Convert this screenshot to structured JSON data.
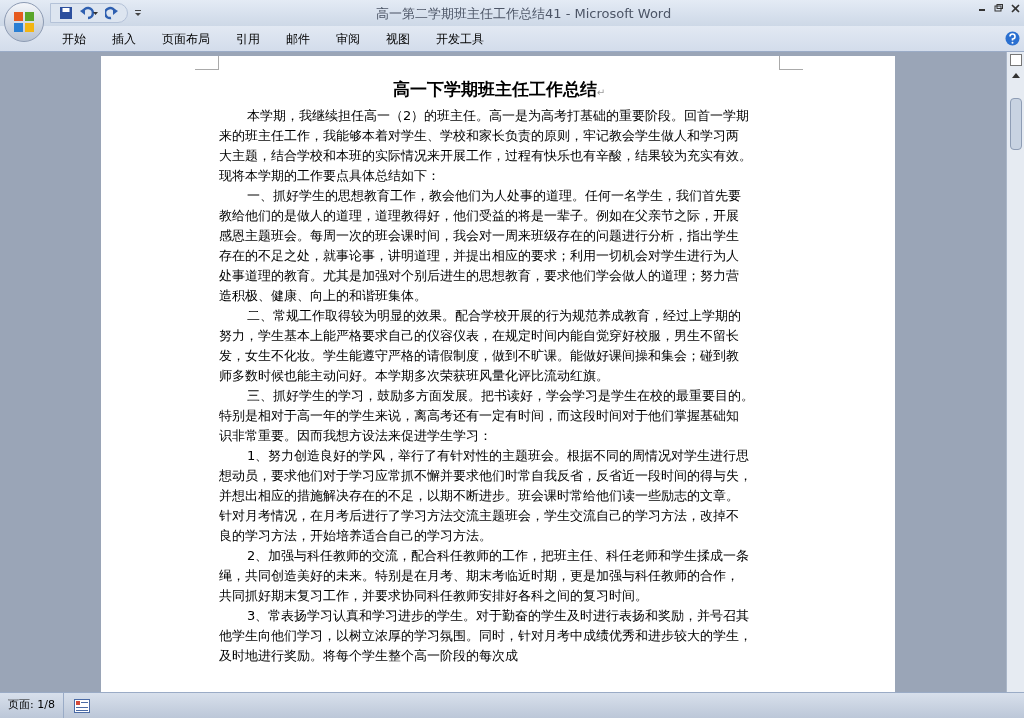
{
  "window": {
    "title": "高一第二学期班主任工作总结41 - Microsoft Word"
  },
  "ribbon_tabs": [
    {
      "label": "开始",
      "selected": false
    },
    {
      "label": "插入",
      "selected": false
    },
    {
      "label": "页面布局",
      "selected": false
    },
    {
      "label": "引用",
      "selected": false
    },
    {
      "label": "邮件",
      "selected": false
    },
    {
      "label": "审阅",
      "selected": false
    },
    {
      "label": "视图",
      "selected": false
    },
    {
      "label": "开发工具",
      "selected": false
    }
  ],
  "document": {
    "title": "高一下学期班主任工作总结",
    "paragraph_mark": "↵",
    "paragraphs": [
      {
        "lines": [
          "本学期，我继续担任高一（2）的班主任。高一是为高考打基础的重要阶段。回首一学期",
          "来的班主任工作，我能够本着对学生、学校和家长负责的原则，牢记教会学生做人和学习两",
          "大主题，结合学校和本班的实际情况来开展工作，过程有快乐也有辛酸，结果较为充实有效。",
          "现将本学期的工作要点具体总结如下："
        ]
      },
      {
        "lines": [
          "一、抓好学生的思想教育工作，教会他们为人处事的道理。任何一名学生，我们首先要",
          "教给他们的是做人的道理，道理教得好，他们受益的将是一辈子。例如在父亲节之际，开展",
          "感恩主题班会。每周一次的班会课时间，我会对一周来班级存在的问题进行分析，指出学生",
          "存在的不足之处，就事论事，讲明道理，并提出相应的要求；利用一切机会对学生进行为人",
          "处事道理的教育。尤其是加强对个别后进生的思想教育，要求他们学会做人的道理；努力营",
          "造积极、健康、向上的和谐班集体。"
        ]
      },
      {
        "lines": [
          "二、常规工作取得较为明显的效果。配合学校开展的行为规范养成教育，经过上学期的",
          "努力，学生基本上能严格要求自己的仪容仪表，在规定时间内能自觉穿好校服，男生不留长",
          "发，女生不化妆。学生能遵守严格的请假制度，做到不旷课。能做好课间操和集会；碰到教",
          "师多数时候也能主动问好。本学期多次荣获班风量化评比流动红旗。"
        ]
      },
      {
        "lines": [
          "三、抓好学生的学习，鼓励多方面发展。把书读好，学会学习是学生在校的最重要目的。",
          "特别是相对于高一年的学生来说，离高考还有一定有时间，而这段时间对于他们掌握基础知",
          "识非常重要。因而我想方设法来促进学生学习："
        ]
      },
      {
        "lines": [
          "1、努力创造良好的学风，举行了有针对性的主题班会。根据不同的周情况对学生进行思",
          "想动员，要求他们对于学习应常抓不懈并要求他们时常自我反省，反省近一段时间的得与失，",
          "并想出相应的措施解决存在的不足，以期不断进步。班会课时常给他们读一些励志的文章。",
          "针对月考情况，在月考后进行了学习方法交流主题班会，学生交流自己的学习方法，改掉不",
          "良的学习方法，开始培养适合自己的学习方法。"
        ]
      },
      {
        "lines": [
          "2、加强与科任教师的交流，配合科任教师的工作，把班主任、科任老师和学生揉成一条",
          "绳，共同创造美好的未来。特别是在月考、期末考临近时期，更是加强与科任教师的合作，",
          "共同抓好期末复习工作，并要求协同科任教师安排好各科之间的复习时间。"
        ]
      },
      {
        "lines": [
          "3、常表扬学习认真和学习进步的学生。对于勤奋的学生及时进行表扬和奖励，并号召其",
          "他学生向他们学习，以树立浓厚的学习氛围。同时，针对月考中成绩优秀和进步较大的学生，",
          "及时地进行奖励。将每个学生整个高一阶段的每次成"
        ]
      }
    ]
  },
  "status_bar": {
    "page": "页面: 1/8"
  }
}
